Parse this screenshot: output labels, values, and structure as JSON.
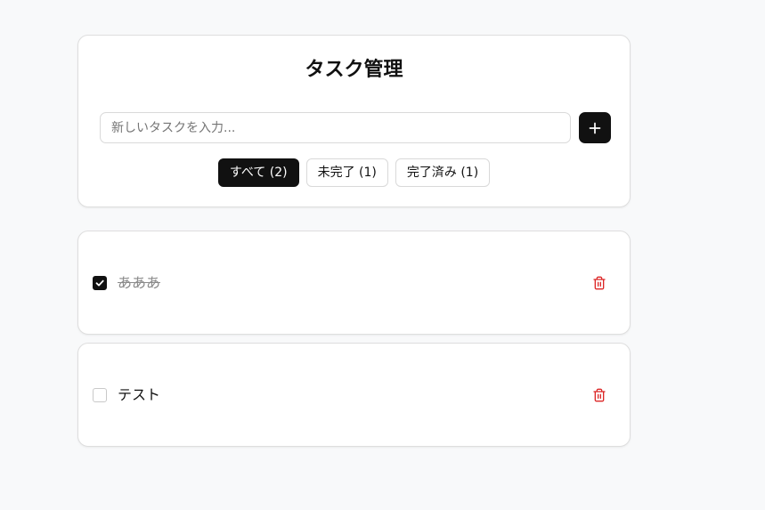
{
  "app": {
    "title": "タスク管理"
  },
  "input": {
    "placeholder": "新しいタスクを入力...",
    "value": ""
  },
  "add_button": {
    "icon": "plus-icon"
  },
  "filters": [
    {
      "label": "すべて (2)",
      "active": true
    },
    {
      "label": "未完了 (1)",
      "active": false
    },
    {
      "label": "完了済み (1)",
      "active": false
    }
  ],
  "tasks": [
    {
      "text": "あああ",
      "completed": true
    },
    {
      "text": "テスト",
      "completed": false
    }
  ],
  "icons": {
    "check": "check-icon",
    "delete": "trash-icon"
  },
  "colors": {
    "primary": "#111111",
    "delete": "#dc2626",
    "background": "#f8f9fa",
    "completed_text": "#8a8a8a"
  }
}
